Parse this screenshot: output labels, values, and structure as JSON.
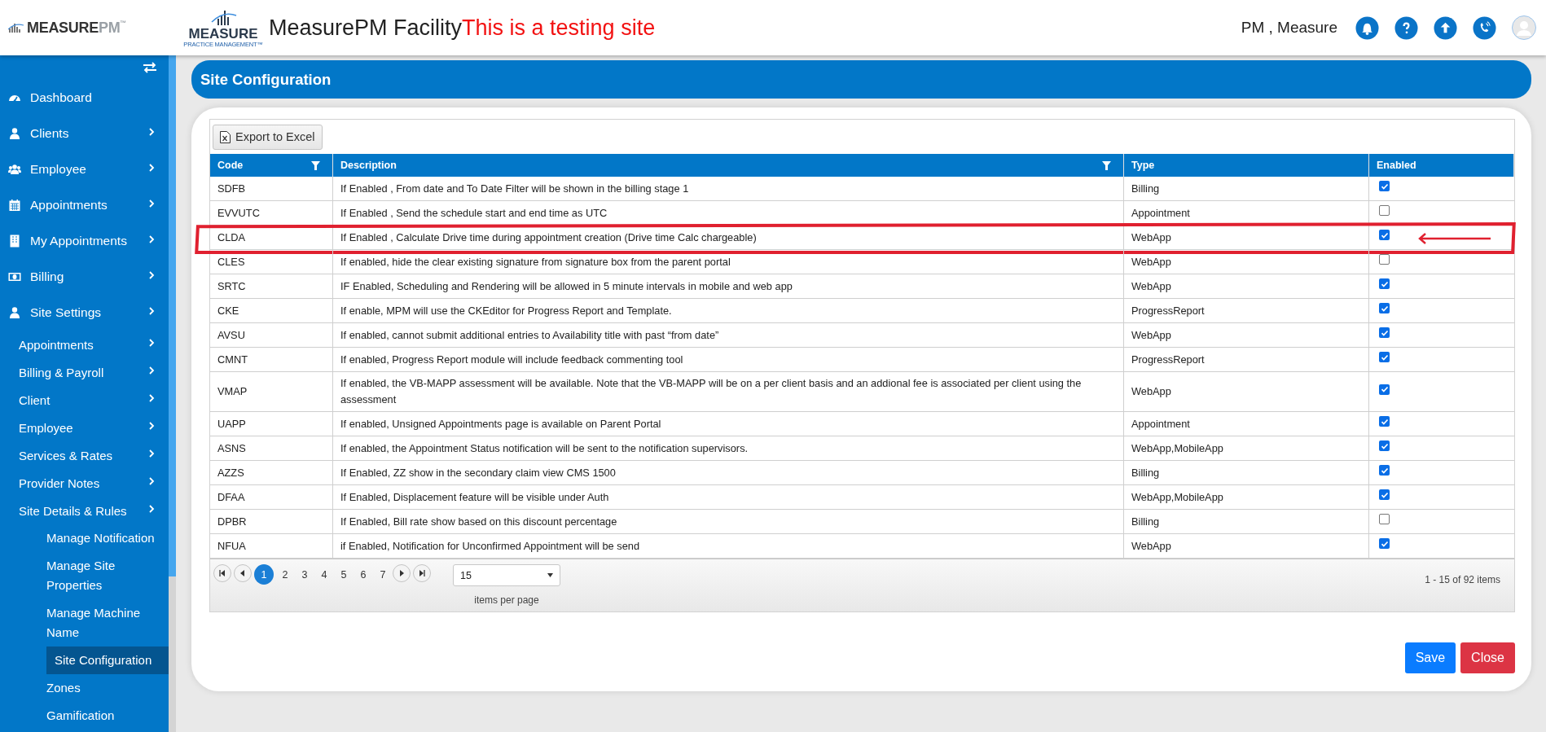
{
  "header": {
    "brand": {
      "main": "MEASURE",
      "accent": "PM",
      "mark": "™"
    },
    "logo": {
      "word": "MEASURE",
      "tagline": "PRACTICE MANAGEMENT™"
    },
    "title": "MeasurePM Facility",
    "notice": "This is a testing site",
    "user": "PM , Measure"
  },
  "sidebar": {
    "items": [
      {
        "label": "Dashboard",
        "expandable": false,
        "selected": false
      },
      {
        "label": "Clients",
        "expandable": true,
        "selected": false
      },
      {
        "label": "Employee",
        "expandable": true,
        "selected": false
      },
      {
        "label": "Appointments",
        "expandable": true,
        "selected": false
      },
      {
        "label": "My Appointments",
        "expandable": true,
        "selected": false
      },
      {
        "label": "Billing",
        "expandable": true,
        "selected": false
      },
      {
        "label": "Site Settings",
        "expandable": true,
        "selected": false,
        "children": [
          {
            "label": "Appointments",
            "expandable": true,
            "selected": false
          },
          {
            "label": "Billing & Payroll",
            "expandable": true,
            "selected": false
          },
          {
            "label": "Client",
            "expandable": true,
            "selected": false
          },
          {
            "label": "Employee",
            "expandable": true,
            "selected": false
          },
          {
            "label": "Services & Rates",
            "expandable": true,
            "selected": false
          },
          {
            "label": "Provider Notes",
            "expandable": true,
            "selected": false
          },
          {
            "label": "Site Details & Rules",
            "expandable": true,
            "selected": false,
            "children": [
              {
                "label": "Manage Notification",
                "expandable": false,
                "selected": false
              },
              {
                "label": "Manage Site Properties",
                "expandable": false,
                "selected": false
              },
              {
                "label": "Manage Machine Name",
                "expandable": false,
                "selected": false
              },
              {
                "label": "Site Configuration",
                "expandable": false,
                "selected": true
              },
              {
                "label": "Zones",
                "expandable": false,
                "selected": false
              },
              {
                "label": "Gamification",
                "expandable": false,
                "selected": false
              }
            ]
          }
        ]
      }
    ]
  },
  "page_title": "Site Configuration",
  "toolbar": {
    "export_button": "Export to Excel"
  },
  "table": {
    "columns": [
      {
        "label": "Code",
        "filter": true
      },
      {
        "label": "Description",
        "filter": true
      },
      {
        "label": "Type",
        "filter": false
      },
      {
        "label": "Enabled",
        "filter": false
      }
    ],
    "rows": [
      {
        "code": "SDFB",
        "description": "If Enabled , From date and To Date Filter will be shown in the billing stage 1",
        "type": "Billing",
        "enabled": true,
        "annotated": false
      },
      {
        "code": "EVVUTC",
        "description": "If Enabled , Send the schedule start and end time as UTC",
        "type": "Appointment",
        "enabled": false,
        "annotated": false
      },
      {
        "code": "CLDA",
        "description": "If Enabled , Calculate Drive time during appointment creation (Drive time Calc chargeable)",
        "type": "WebApp",
        "enabled": true,
        "annotated": true
      },
      {
        "code": "CLES",
        "description": "If enabled, hide the clear existing signature from signature box from the parent portal",
        "type": "WebApp",
        "enabled": false,
        "annotated": false
      },
      {
        "code": "SRTC",
        "description": "IF Enabled, Scheduling and Rendering will be allowed in 5 minute intervals in mobile and web app",
        "type": "WebApp",
        "enabled": true,
        "annotated": false
      },
      {
        "code": "CKE",
        "description": "If enable, MPM will use the CKEditor for Progress Report and Template.",
        "type": "ProgressReport",
        "enabled": true,
        "annotated": false
      },
      {
        "code": "AVSU",
        "description": "If enabled, cannot submit additional entries to Availability title with past “from date”",
        "type": "WebApp",
        "enabled": true,
        "annotated": false
      },
      {
        "code": "CMNT",
        "description": "If enabled, Progress Report module will include feedback commenting tool",
        "type": "ProgressReport",
        "enabled": true,
        "annotated": false
      },
      {
        "code": "VMAP",
        "description": "If enabled, the VB-MAPP assessment will be available. Note that the VB-MAPP will be on a per client basis and an addional fee is associated per client using the assessment",
        "type": "WebApp",
        "enabled": true,
        "annotated": false
      },
      {
        "code": "UAPP",
        "description": "If enabled, Unsigned Appointments page is available on Parent Portal",
        "type": "Appointment",
        "enabled": true,
        "annotated": false
      },
      {
        "code": "ASNS",
        "description": "If enabled, the Appointment Status notification will be sent to the notification supervisors.",
        "type": "WebApp,MobileApp",
        "enabled": true,
        "annotated": false
      },
      {
        "code": "AZZS",
        "description": "If Enabled, ZZ show in the secondary claim view CMS 1500",
        "type": "Billing",
        "enabled": true,
        "annotated": false
      },
      {
        "code": "DFAA",
        "description": "If Enabled, Displacement feature will be visible under Auth",
        "type": "WebApp,MobileApp",
        "enabled": true,
        "annotated": false
      },
      {
        "code": "DPBR",
        "description": "If Enabled, Bill rate show based on this discount percentage",
        "type": "Billing",
        "enabled": false,
        "annotated": false
      },
      {
        "code": "NFUA",
        "description": "if Enabled, Notification for Unconfirmed Appointment will be send",
        "type": "WebApp",
        "enabled": true,
        "annotated": false
      }
    ]
  },
  "pager": {
    "pages": [
      {
        "label": "1",
        "selected": true
      },
      {
        "label": "2",
        "selected": false
      },
      {
        "label": "3",
        "selected": false
      },
      {
        "label": "4",
        "selected": false
      },
      {
        "label": "5",
        "selected": false
      },
      {
        "label": "6",
        "selected": false
      },
      {
        "label": "7",
        "selected": false
      }
    ],
    "page_size": "15",
    "page_size_label": "items per page",
    "summary": "1 - 15 of 92 items"
  },
  "buttons": [
    {
      "label": "Save",
      "kind": "primary"
    },
    {
      "label": "Close",
      "kind": "danger"
    }
  ]
}
